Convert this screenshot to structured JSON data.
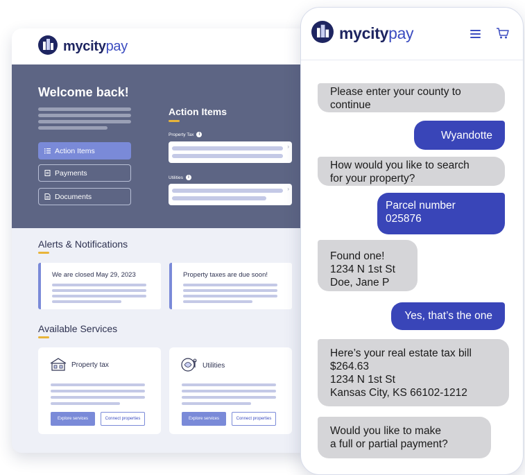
{
  "brand": {
    "name_bold": "mycity",
    "name_light": "pay"
  },
  "desktop": {
    "welcome": "Welcome back!",
    "nav": [
      {
        "label": "Action Items",
        "icon": "list-icon",
        "active": true
      },
      {
        "label": "Payments",
        "icon": "receipt-icon",
        "active": false
      },
      {
        "label": "Documents",
        "icon": "document-icon",
        "active": false
      }
    ],
    "action_items": {
      "title": "Action Items",
      "groups": [
        {
          "label": "Property Tax"
        },
        {
          "label": "Utilities"
        }
      ]
    },
    "alerts": {
      "title": "Alerts & Notifications",
      "items": [
        {
          "title": "We are closed May 29, 2023"
        },
        {
          "title": "Property taxes are due soon!"
        }
      ]
    },
    "services": {
      "title": "Available Services",
      "items": [
        {
          "title": "Property tax",
          "icon": "house-icon",
          "primary": "Explore services",
          "secondary": "Connect properties"
        },
        {
          "title": "Utilities",
          "icon": "utilities-icon",
          "primary": "Explore services",
          "secondary": "Connect properties"
        }
      ]
    }
  },
  "chat": {
    "messages": [
      {
        "from": "bot",
        "text": "Please enter your county to\ncontinue"
      },
      {
        "from": "user",
        "text": "Wyandotte"
      },
      {
        "from": "bot",
        "text": "How would you like to search\nfor your property?"
      },
      {
        "from": "user",
        "text": "Parcel number\n025876"
      },
      {
        "from": "bot",
        "text": "Found one!\n1234 N 1st St\nDoe, Jane P"
      },
      {
        "from": "user",
        "text": "Yes, that’s the one"
      },
      {
        "from": "bot",
        "text": "Here’s your real estate tax bill\n$264.63\n1234 N 1st St\nKansas City, KS 66102-1212"
      },
      {
        "from": "bot",
        "text": "Would you like to make\na full or partial payment?"
      }
    ]
  },
  "colors": {
    "navy": "#1e2561",
    "accent": "#3945b8",
    "hero": "#5d6584",
    "highlight": "#e8b43a"
  }
}
